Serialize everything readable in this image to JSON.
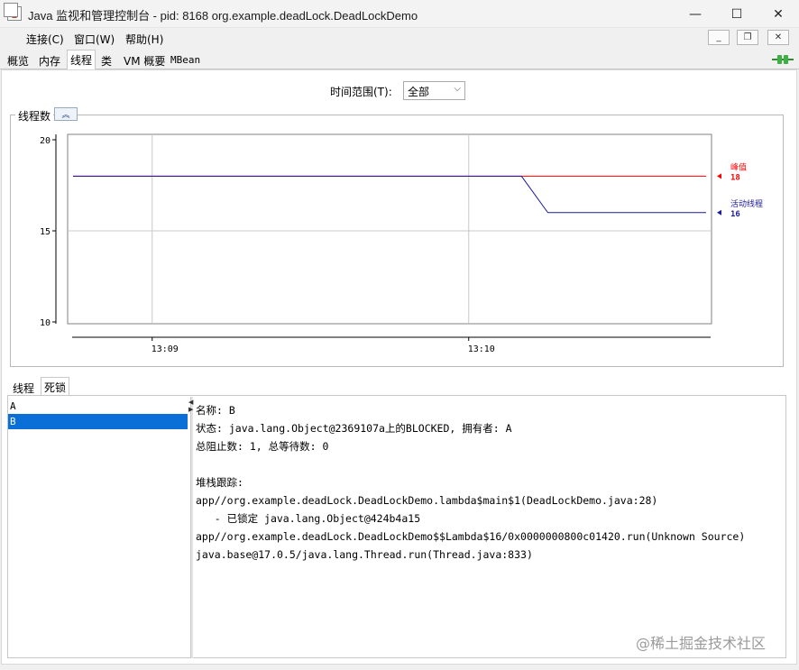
{
  "window": {
    "title": "Java 监视和管理控制台 - pid: 8168 org.example.deadLock.DeadLockDemo",
    "minimize": "—",
    "maximize": "☐",
    "close": "✕"
  },
  "menu": {
    "items": [
      "连接(C)",
      "窗口(W)",
      "帮助(H)"
    ],
    "mdi_minimize": "_",
    "mdi_restore": "❐",
    "mdi_close": "✕"
  },
  "tabs": [
    "概览",
    "内存",
    "线程",
    "类",
    "VM 概要",
    "MBean"
  ],
  "active_tab": "线程",
  "time_range": {
    "label": "时间范围(T):",
    "value": "全部"
  },
  "chart": {
    "group_title": "线程数",
    "collapse_icon": "chevron-up-icon",
    "chart_data": {
      "type": "line",
      "x": [
        "13:08:45",
        "13:09",
        "13:10",
        "13:10:10",
        "13:10:15",
        "13:10:45"
      ],
      "x_ticks": [
        "13:09",
        "13:10"
      ],
      "y_ticks": [
        "20",
        "15",
        "10"
      ],
      "ylim": [
        10,
        20
      ],
      "series": [
        {
          "name": "峰值",
          "value_label": "18",
          "color": "#ff0000",
          "values": [
            18,
            18,
            18,
            18,
            18,
            18
          ]
        },
        {
          "name": "活动线程",
          "value_label": "16",
          "color": "#1c1c9c",
          "values": [
            18,
            18,
            18,
            18,
            16,
            16
          ]
        }
      ],
      "grid": true,
      "legend": "right"
    }
  },
  "bottom_tabs": [
    "线程",
    "死锁"
  ],
  "active_bottom_tab": "死锁",
  "threads": [
    {
      "name": "A",
      "selected": false
    },
    {
      "name": "B",
      "selected": true
    }
  ],
  "detail": {
    "name_line": "名称: B",
    "state_line": "状态: java.lang.Object@2369107a上的BLOCKED, 拥有者: A",
    "counts_line": "总阻止数: 1, 总等待数: 0",
    "stack_header": "堆栈跟踪:",
    "stack": [
      "app//org.example.deadLock.DeadLockDemo.lambda$main$1(DeadLockDemo.java:28)",
      "   - 已锁定 java.lang.Object@424b4a15",
      "app//org.example.deadLock.DeadLockDemo$$Lambda$16/0x0000000800c01420.run(Unknown Source)",
      "java.base@17.0.5/java.lang.Thread.run(Thread.java:833)"
    ]
  },
  "watermark": "@稀土掘金技术社区"
}
